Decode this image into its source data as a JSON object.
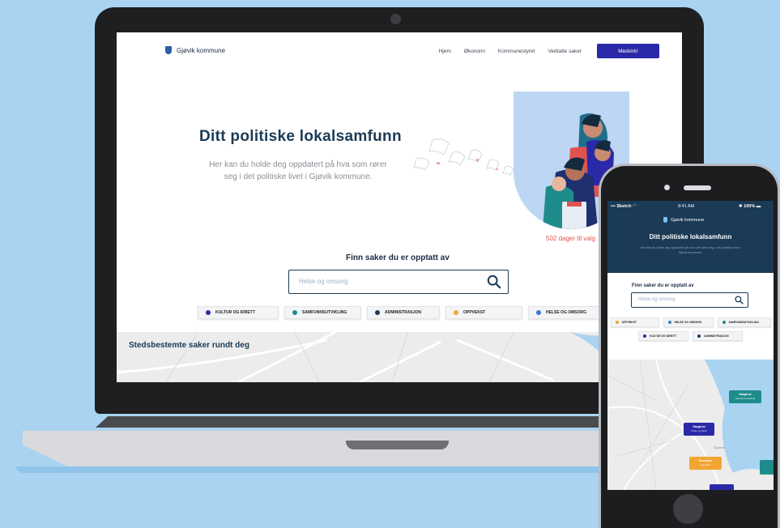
{
  "site": {
    "brand": "Gjøvik kommune",
    "nav": [
      "Hjem",
      "Økonomi",
      "Kommunestyret",
      "Vedtatte saker"
    ],
    "cta_label": "Medvirk!",
    "hero_title": "Ditt politiske lokalsamfunn",
    "hero_subtitle": "Her kan du holde deg oppdatert på hva som rører seg i det politiske livet i Gjøvik kommune.",
    "days_text": "502 dager til valg",
    "find_title": "Finn saker du er opptatt av",
    "search_placeholder": "Helse og omsorg",
    "categories": [
      {
        "label": "KULTUR OG IDRETT",
        "color": "#2a2aa8"
      },
      {
        "label": "SAMFUNNSUTVIKLING",
        "color": "#1f8c8c"
      },
      {
        "label": "ADMINISTRASJON",
        "color": "#1a3a55"
      },
      {
        "label": "OPPVEKST",
        "color": "#f2a531"
      },
      {
        "label": "HELSE OG OMSORG",
        "color": "#3a7bc8"
      }
    ],
    "map_title": "Stedsbestemte saker rundt deg"
  },
  "phone": {
    "carrier": "Sketch",
    "time": "9:41 AM",
    "battery": "100%",
    "brand": "Gjøvik kommune",
    "title": "Ditt politiske lokalsamfunn",
    "subtitle": "Her kan du holde deg oppdatert på hva som rører seg i det politiske livet i Gjøvik kommune.",
    "find_title": "Finn saker du er opptatt av",
    "search_placeholder": "Helse og omsorg",
    "categories": [
      {
        "label": "OPPVEKST",
        "color": "#f2a531"
      },
      {
        "label": "HELSE OG OMSORG",
        "color": "#3a7bc8"
      },
      {
        "label": "SAMFUNNSUTVIKLING",
        "color": "#1f8c8c"
      },
      {
        "label": "KULTUR OG IDRETT",
        "color": "#2a2aa8"
      },
      {
        "label": "ADMINISTRASJON",
        "color": "#1a3a55"
      }
    ],
    "map_place": "Gjøvik",
    "markers": [
      {
        "title": "Haughus",
        "sub": "Samfunnsutvikling",
        "color": "#1f8c8c"
      },
      {
        "title": "Haughus",
        "sub": "Kultur og idrett",
        "color": "#2a2aa8"
      },
      {
        "title": "Hunnsjen",
        "sub": "Oppvekst",
        "color": "#f2a531"
      }
    ]
  }
}
